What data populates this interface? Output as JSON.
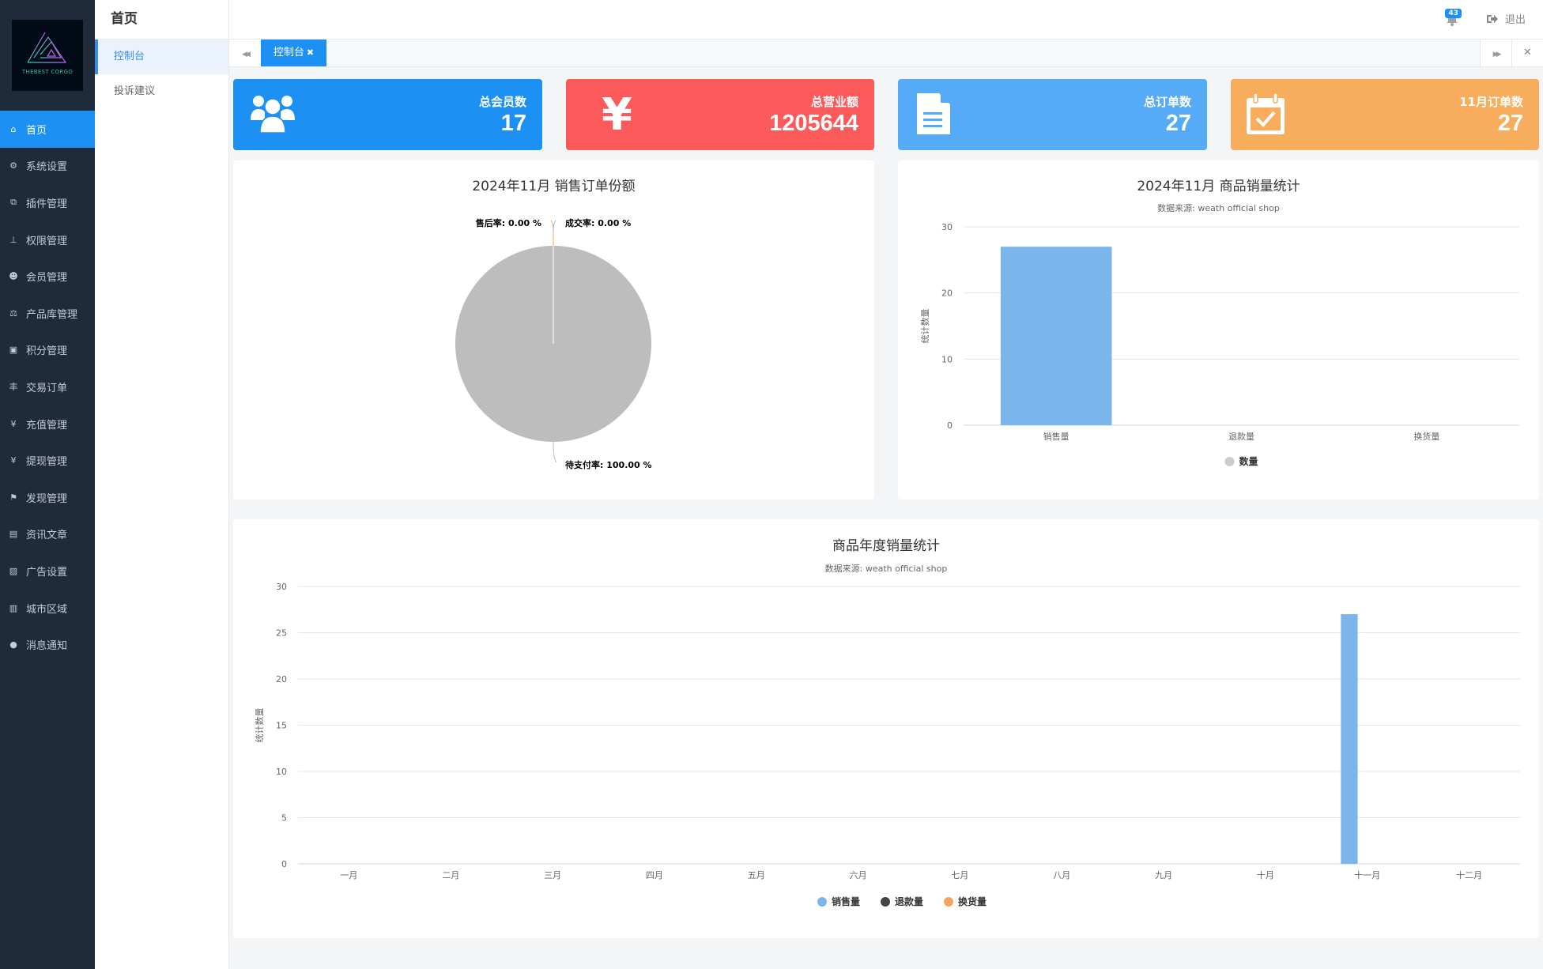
{
  "sidebar": {
    "logo_text": "THEBEST CORGO",
    "items": [
      {
        "label": "首页",
        "icon": "home-icon",
        "glyph": "⌂",
        "active": true
      },
      {
        "label": "系统设置",
        "icon": "gear-icon",
        "glyph": "⚙"
      },
      {
        "label": "插件管理",
        "icon": "plugin-icon",
        "glyph": "⧉"
      },
      {
        "label": "权限管理",
        "icon": "sitemap-icon",
        "glyph": "⊥"
      },
      {
        "label": "会员管理",
        "icon": "users-icon",
        "glyph": "☻"
      },
      {
        "label": "产品库管理",
        "icon": "balance-scale-icon",
        "glyph": "⚖"
      },
      {
        "label": "积分管理",
        "icon": "points-file-icon",
        "glyph": "▣"
      },
      {
        "label": "交易订单",
        "icon": "yen-sign-icon",
        "glyph": "丰"
      },
      {
        "label": "充值管理",
        "icon": "yen-icon",
        "glyph": "¥"
      },
      {
        "label": "提现管理",
        "icon": "yen-icon",
        "glyph": "¥"
      },
      {
        "label": "发现管理",
        "icon": "flag-icon",
        "glyph": "⚑"
      },
      {
        "label": "资讯文章",
        "icon": "newspaper-icon",
        "glyph": "▤"
      },
      {
        "label": "广告设置",
        "icon": "image-icon",
        "glyph": "▨"
      },
      {
        "label": "城市区域",
        "icon": "map-icon",
        "glyph": "▥"
      },
      {
        "label": "消息通知",
        "icon": "comment-icon",
        "glyph": "●"
      }
    ]
  },
  "subbar": {
    "title": "首页",
    "items": [
      {
        "label": "控制台",
        "active": true
      },
      {
        "label": "投诉建议"
      }
    ]
  },
  "topbar": {
    "notification_count": "43",
    "logout_label": "退出"
  },
  "tabs": [
    {
      "label": "控制台",
      "close": "✖"
    }
  ],
  "tabbar_icons": {
    "prev": "◀◀",
    "next": "▶▶",
    "close_all": "✕"
  },
  "stats": [
    {
      "label": "总会员数",
      "value": "17",
      "color": "#1c90f3",
      "icon": "users-icon"
    },
    {
      "label": "总营业额",
      "value": "1205644",
      "color": "#fc5a5a",
      "icon": "yen-icon"
    },
    {
      "label": "总订单数",
      "value": "27",
      "color": "#55abf6",
      "icon": "document-icon"
    },
    {
      "label": "11月订单数",
      "value": "27",
      "color": "#f7ad5c",
      "icon": "calendar-check-icon"
    }
  ],
  "chart_data": [
    {
      "type": "pie",
      "title": "2024年11月 销售订单份额",
      "slices": [
        {
          "label": "售后率",
          "value": 0.0,
          "display": "售后率: 0.00 %",
          "color": "#f7a35c"
        },
        {
          "label": "成交率",
          "value": 0.0,
          "display": "成交率: 0.00 %",
          "color": "#7cb5ec"
        },
        {
          "label": "待支付率",
          "value": 100.0,
          "display": "待支付率: 100.00 %",
          "color": "#bdbdbd"
        }
      ]
    },
    {
      "type": "bar",
      "title": "2024年11月 商品销量统计",
      "subtitle": "数据来源: weath official shop",
      "categories": [
        "销售量",
        "退款量",
        "换货量"
      ],
      "series": [
        {
          "name": "数量",
          "values": [
            27,
            0,
            0
          ],
          "color": "#7cb5ec",
          "legend_color": "#cccccc"
        }
      ],
      "ylabel": "统计数量",
      "yticks": [
        0,
        10,
        20,
        30
      ],
      "ylim": [
        0,
        30
      ],
      "legend": "bottom-center"
    },
    {
      "type": "bar",
      "title": "商品年度销量统计",
      "subtitle": "数据来源: weath official shop",
      "categories": [
        "一月",
        "二月",
        "三月",
        "四月",
        "五月",
        "六月",
        "七月",
        "八月",
        "九月",
        "十月",
        "十一月",
        "十二月"
      ],
      "series": [
        {
          "name": "销售量",
          "values": [
            0,
            0,
            0,
            0,
            0,
            0,
            0,
            0,
            0,
            0,
            27,
            0
          ],
          "color": "#7cb5ec"
        },
        {
          "name": "退款量",
          "values": [
            0,
            0,
            0,
            0,
            0,
            0,
            0,
            0,
            0,
            0,
            0,
            0
          ],
          "color": "#434348"
        },
        {
          "name": "换货量",
          "values": [
            0,
            0,
            0,
            0,
            0,
            0,
            0,
            0,
            0,
            0,
            0,
            0
          ],
          "color": "#f7a35c"
        }
      ],
      "ylabel": "统计数量",
      "yticks": [
        0,
        5,
        10,
        15,
        20,
        25,
        30
      ],
      "ylim": [
        0,
        30
      ],
      "legend": "bottom-center"
    }
  ]
}
